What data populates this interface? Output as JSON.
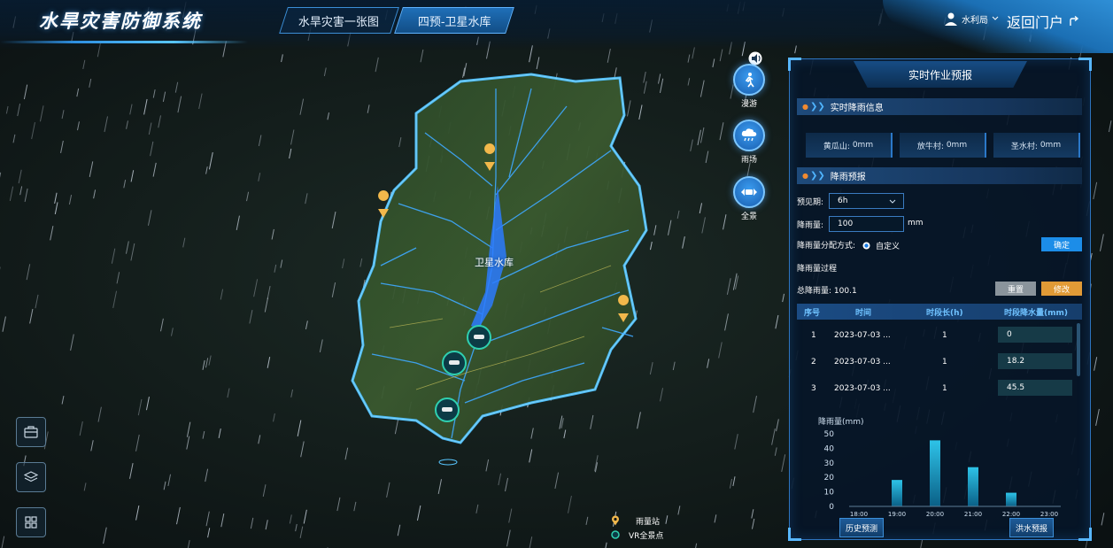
{
  "header": {
    "title": "水旱灾害防御系统",
    "tabs": [
      {
        "label": "水旱灾害一张图",
        "active": false
      },
      {
        "label": "四预-卫星水库",
        "active": true
      }
    ],
    "user": "水利局",
    "portal": "返回门户"
  },
  "map": {
    "reservoir_label": "卫星水库",
    "tools": [
      {
        "label": "漫游",
        "icon": "person-walk-icon"
      },
      {
        "label": "雨场",
        "icon": "rain-cloud-icon"
      },
      {
        "label": "全景",
        "icon": "panorama-icon"
      }
    ],
    "legend": [
      {
        "label": "雨量站",
        "icon": "rain-station-pin-icon",
        "color": "#f2b84b"
      },
      {
        "label": "VR全景点",
        "icon": "vr-point-icon",
        "color": "#2fd0b0"
      }
    ]
  },
  "panel": {
    "title": "实时作业预报",
    "realtime_section": "实时降雨信息",
    "stations": [
      {
        "name": "黄瓜山:",
        "value": "0mm"
      },
      {
        "name": "放牛村:",
        "value": "0mm"
      },
      {
        "name": "圣水村:",
        "value": "0mm"
      }
    ],
    "forecast_section": "降雨预报",
    "period_label": "预见期:",
    "period_value": "6h",
    "rain_label": "降雨量:",
    "rain_value": "100",
    "rain_unit": "mm",
    "dist_label": "降雨量分配方式:",
    "dist_option": "自定义",
    "confirm": "确定",
    "process_label": "降雨量过程",
    "total_label": "总降雨量:",
    "total_value": "100.1",
    "reset": "重置",
    "modify": "修改",
    "table": {
      "headers": [
        "序号",
        "时间",
        "时段长(h)",
        "时段降水量(mm)"
      ],
      "rows": [
        {
          "no": "1",
          "time": "2023-07-03 ...",
          "len": "1",
          "rain": "0"
        },
        {
          "no": "2",
          "time": "2023-07-03 ...",
          "len": "1",
          "rain": "18.2"
        },
        {
          "no": "3",
          "time": "2023-07-03 ...",
          "len": "1",
          "rain": "45.5"
        }
      ]
    },
    "history_btn": "历史预测",
    "flood_btn": "洪水预报"
  },
  "chart_data": {
    "type": "bar",
    "title": "",
    "ylabel": "降雨量(mm)",
    "xlabel": "",
    "categories": [
      "18:00",
      "19:00",
      "20:00",
      "21:00",
      "22:00",
      "23:00"
    ],
    "x_bars": [
      19.0,
      20.0,
      21.0,
      22.0
    ],
    "values": [
      18.2,
      45.5,
      27.0,
      9.4
    ],
    "yticks": [
      0,
      10,
      20,
      30,
      40,
      50
    ],
    "ylim": [
      0,
      50
    ],
    "bar_color": "#2ec3e8",
    "grid": false
  }
}
